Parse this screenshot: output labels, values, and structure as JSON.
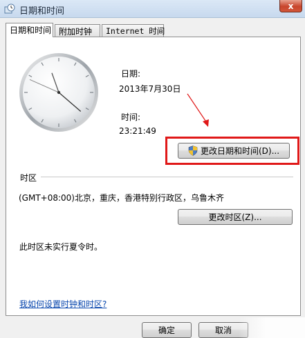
{
  "window": {
    "title": "日期和时间",
    "close_label": "x"
  },
  "tabs": [
    {
      "label": "日期和时间",
      "active": true
    },
    {
      "label": "附加时钟",
      "active": false
    },
    {
      "label": "Internet 时间",
      "active": false
    }
  ],
  "date": {
    "label": "日期:",
    "value": "2013年7月30日"
  },
  "time": {
    "label": "时间:",
    "value": "23:21:49"
  },
  "change_datetime_button": "更改日期和时间(D)...",
  "timezone": {
    "section_label": "时区",
    "value": "(GMT+08:00)北京，重庆，香港特别行政区，乌鲁木齐",
    "change_button": "更改时区(Z)..."
  },
  "dst_note": "此时区未实行夏令时。",
  "help_link": "我如何设置时钟和时区?",
  "footer": {
    "ok": "确定",
    "cancel": "取消"
  },
  "icons": {
    "title": "clock-settings-icon",
    "shield": "uac-shield-icon"
  },
  "colors": {
    "highlight": "#e01818",
    "annotation_arrow": "#e01818",
    "link": "#0645ad"
  }
}
